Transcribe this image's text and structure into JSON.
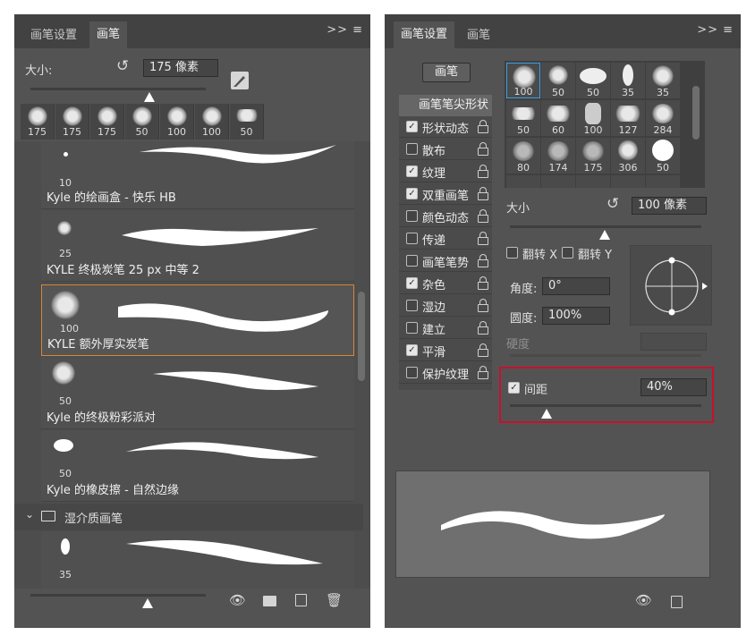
{
  "left_panel": {
    "tabs": [
      "画笔设置",
      "画笔"
    ],
    "menu_glyph": ">> ≡",
    "size_label": "大小:",
    "size_value": "175 像素",
    "size_slider_fraction": 0.5,
    "recent_tips": [
      "175",
      "175",
      "175",
      "50",
      "100",
      "100",
      "50"
    ],
    "brushes": [
      {
        "num": "10",
        "name": "Kyle 的绘画盒 - 快乐 HB"
      },
      {
        "num": "25",
        "name": "KYLE 终极炭笔 25 px 中等 2"
      },
      {
        "num": "100",
        "name": "KYLE 额外厚实炭笔",
        "selected": true
      },
      {
        "num": "50",
        "name": "Kyle 的终极粉彩派对"
      },
      {
        "num": "50",
        "name": "Kyle 的橡皮擦 - 自然边缘"
      }
    ],
    "group_name": "湿介质画笔",
    "last_brush_num": "35",
    "bottom_slider_fraction": 0.5
  },
  "right_panel": {
    "tabs": [
      "画笔设置",
      "画笔"
    ],
    "menu_glyph": ">> ≡",
    "brush_button": "画笔",
    "tip_shape_label": "画笔笔尖形状",
    "options": [
      {
        "label": "形状动态",
        "checked": true
      },
      {
        "label": "散布",
        "checked": false
      },
      {
        "label": "纹理",
        "checked": true
      },
      {
        "label": "双重画笔",
        "checked": true
      },
      {
        "label": "颜色动态",
        "checked": false
      },
      {
        "label": "传递",
        "checked": false
      },
      {
        "label": "画笔笔势",
        "checked": false
      },
      {
        "label": "杂色",
        "checked": true
      },
      {
        "label": "湿边",
        "checked": false
      },
      {
        "label": "建立",
        "checked": false
      },
      {
        "label": "平滑",
        "checked": true
      },
      {
        "label": "保护纹理",
        "checked": false
      }
    ],
    "tip_grid_numbers": [
      "100",
      "50",
      "50",
      "35",
      "35",
      "50",
      "60",
      "100",
      "127",
      "284",
      "80",
      "174",
      "175",
      "306",
      "50"
    ],
    "size_label": "大小",
    "size_value": "100 像素",
    "size_slider_fraction": 0.5,
    "flip_x": "翻转 X",
    "flip_y": "翻转 Y",
    "angle_label": "角度:",
    "angle_value": "0°",
    "roundness_label": "圆度:",
    "roundness_value": "100%",
    "hardness_label": "硬度",
    "spacing_label": "间距",
    "spacing_value": "40%",
    "spacing_checked": true,
    "spacing_slider_fraction": 0.2,
    "highlight_color": "#c8102e"
  }
}
